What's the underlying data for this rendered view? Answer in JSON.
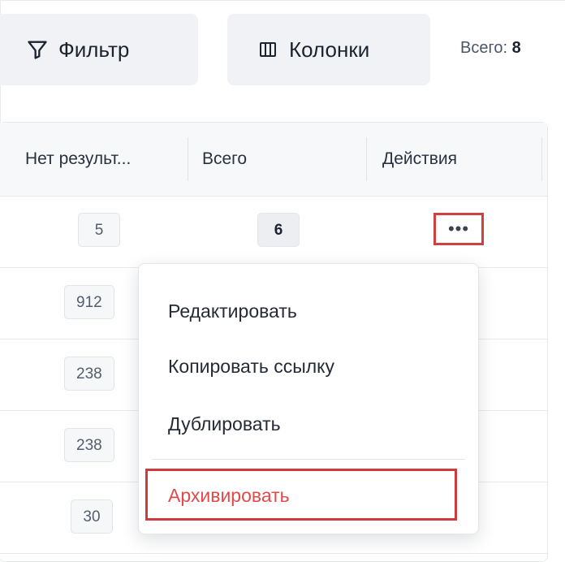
{
  "toolbar": {
    "filter_label": "Фильтр",
    "filter_icon": "filter-funnel-icon",
    "columns_label": "Колонки",
    "columns_icon": "columns-icon",
    "total_label": "Всего:",
    "total_value": "8"
  },
  "table": {
    "headers": [
      "Нет результ...",
      "Всего",
      "Действия"
    ],
    "rows": [
      {
        "no_result": "5",
        "total": "6"
      },
      {
        "no_result": "912"
      },
      {
        "no_result": "238"
      },
      {
        "no_result": "238"
      },
      {
        "no_result": "30"
      }
    ],
    "actions_icon": "more-horizontal-icon"
  },
  "context_menu": {
    "items": [
      {
        "label": "Редактировать"
      },
      {
        "label": "Копировать ссылку"
      },
      {
        "label": "Дублировать"
      },
      {
        "label": "Архивировать",
        "danger": true
      }
    ]
  },
  "colors": {
    "accent_danger": "#e24a4a",
    "highlight_border": "#cf3b3b",
    "button_bg": "#f1f2f5"
  }
}
